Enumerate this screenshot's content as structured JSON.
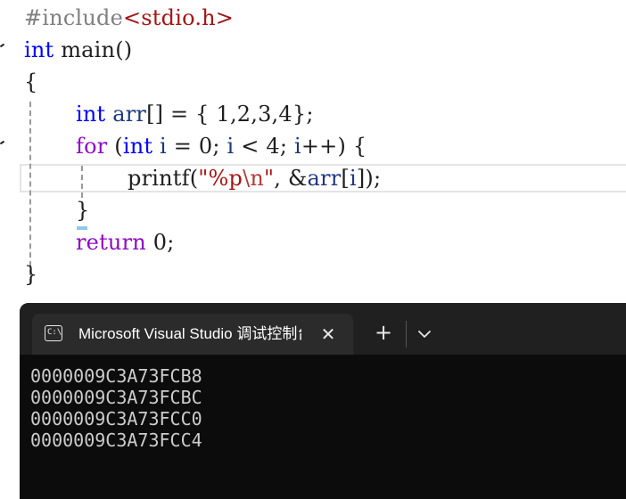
{
  "editor": {
    "lines": {
      "l1_directive": "#include",
      "l1_header": "<stdio.h>",
      "l2_type": "int",
      "l2_rest": " main()",
      "l3": "{",
      "l4_type": "int",
      "l4_var": "arr",
      "l4_rest": "[] = { 1,2,3,4};",
      "l5_for": "for",
      "l5_a": " (",
      "l5_type": "int",
      "l5_i1": "i",
      "l5_b": " = 0; ",
      "l5_i2": "i",
      "l5_c": " < 4; ",
      "l5_i3": "i",
      "l5_d": "++) {",
      "l6_fn": "printf(",
      "l6_str1": "\"%p",
      "l6_esc": "\\n",
      "l6_str2": "\"",
      "l6_comma": ", &",
      "l6_var": "arr",
      "l6_b": "[",
      "l6_i": "i",
      "l6_end": "]);",
      "l7": "}",
      "l8_return": "return",
      "l8_rest": " 0;",
      "l9": "}"
    }
  },
  "terminal": {
    "tab_title": "Microsoft Visual Studio 调试控制台",
    "tab_icon_glyph": "C:\\",
    "close_glyph": "✕",
    "new_tab_glyph": "+",
    "output": [
      "0000009C3A73FCB8",
      "0000009C3A73FCBC",
      "0000009C3A73FCC0",
      "0000009C3A73FCC4"
    ]
  }
}
